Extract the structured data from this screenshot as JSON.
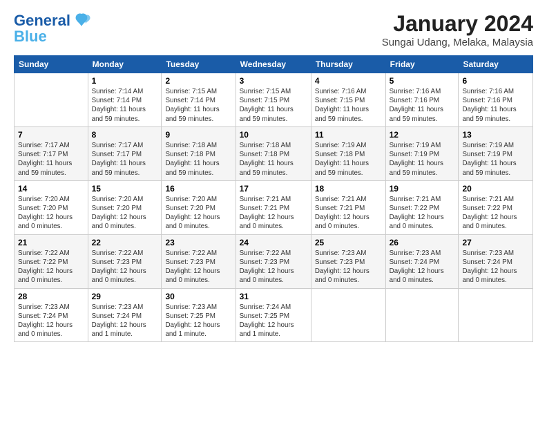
{
  "logo": {
    "line1": "General",
    "line2": "Blue"
  },
  "title": "January 2024",
  "subtitle": "Sungai Udang, Melaka, Malaysia",
  "days": [
    "Sunday",
    "Monday",
    "Tuesday",
    "Wednesday",
    "Thursday",
    "Friday",
    "Saturday"
  ],
  "weeks": [
    [
      {
        "day": "",
        "info": ""
      },
      {
        "day": "1",
        "info": "Sunrise: 7:14 AM\nSunset: 7:14 PM\nDaylight: 11 hours\nand 59 minutes."
      },
      {
        "day": "2",
        "info": "Sunrise: 7:15 AM\nSunset: 7:14 PM\nDaylight: 11 hours\nand 59 minutes."
      },
      {
        "day": "3",
        "info": "Sunrise: 7:15 AM\nSunset: 7:15 PM\nDaylight: 11 hours\nand 59 minutes."
      },
      {
        "day": "4",
        "info": "Sunrise: 7:16 AM\nSunset: 7:15 PM\nDaylight: 11 hours\nand 59 minutes."
      },
      {
        "day": "5",
        "info": "Sunrise: 7:16 AM\nSunset: 7:16 PM\nDaylight: 11 hours\nand 59 minutes."
      },
      {
        "day": "6",
        "info": "Sunrise: 7:16 AM\nSunset: 7:16 PM\nDaylight: 11 hours\nand 59 minutes."
      }
    ],
    [
      {
        "day": "7",
        "info": "Sunrise: 7:17 AM\nSunset: 7:17 PM\nDaylight: 11 hours\nand 59 minutes."
      },
      {
        "day": "8",
        "info": "Sunrise: 7:17 AM\nSunset: 7:17 PM\nDaylight: 11 hours\nand 59 minutes."
      },
      {
        "day": "9",
        "info": "Sunrise: 7:18 AM\nSunset: 7:18 PM\nDaylight: 11 hours\nand 59 minutes."
      },
      {
        "day": "10",
        "info": "Sunrise: 7:18 AM\nSunset: 7:18 PM\nDaylight: 11 hours\nand 59 minutes."
      },
      {
        "day": "11",
        "info": "Sunrise: 7:19 AM\nSunset: 7:18 PM\nDaylight: 11 hours\nand 59 minutes."
      },
      {
        "day": "12",
        "info": "Sunrise: 7:19 AM\nSunset: 7:19 PM\nDaylight: 11 hours\nand 59 minutes."
      },
      {
        "day": "13",
        "info": "Sunrise: 7:19 AM\nSunset: 7:19 PM\nDaylight: 11 hours\nand 59 minutes."
      }
    ],
    [
      {
        "day": "14",
        "info": "Sunrise: 7:20 AM\nSunset: 7:20 PM\nDaylight: 12 hours\nand 0 minutes."
      },
      {
        "day": "15",
        "info": "Sunrise: 7:20 AM\nSunset: 7:20 PM\nDaylight: 12 hours\nand 0 minutes."
      },
      {
        "day": "16",
        "info": "Sunrise: 7:20 AM\nSunset: 7:20 PM\nDaylight: 12 hours\nand 0 minutes."
      },
      {
        "day": "17",
        "info": "Sunrise: 7:21 AM\nSunset: 7:21 PM\nDaylight: 12 hours\nand 0 minutes."
      },
      {
        "day": "18",
        "info": "Sunrise: 7:21 AM\nSunset: 7:21 PM\nDaylight: 12 hours\nand 0 minutes."
      },
      {
        "day": "19",
        "info": "Sunrise: 7:21 AM\nSunset: 7:22 PM\nDaylight: 12 hours\nand 0 minutes."
      },
      {
        "day": "20",
        "info": "Sunrise: 7:21 AM\nSunset: 7:22 PM\nDaylight: 12 hours\nand 0 minutes."
      }
    ],
    [
      {
        "day": "21",
        "info": "Sunrise: 7:22 AM\nSunset: 7:22 PM\nDaylight: 12 hours\nand 0 minutes."
      },
      {
        "day": "22",
        "info": "Sunrise: 7:22 AM\nSunset: 7:23 PM\nDaylight: 12 hours\nand 0 minutes."
      },
      {
        "day": "23",
        "info": "Sunrise: 7:22 AM\nSunset: 7:23 PM\nDaylight: 12 hours\nand 0 minutes."
      },
      {
        "day": "24",
        "info": "Sunrise: 7:22 AM\nSunset: 7:23 PM\nDaylight: 12 hours\nand 0 minutes."
      },
      {
        "day": "25",
        "info": "Sunrise: 7:23 AM\nSunset: 7:23 PM\nDaylight: 12 hours\nand 0 minutes."
      },
      {
        "day": "26",
        "info": "Sunrise: 7:23 AM\nSunset: 7:24 PM\nDaylight: 12 hours\nand 0 minutes."
      },
      {
        "day": "27",
        "info": "Sunrise: 7:23 AM\nSunset: 7:24 PM\nDaylight: 12 hours\nand 0 minutes."
      }
    ],
    [
      {
        "day": "28",
        "info": "Sunrise: 7:23 AM\nSunset: 7:24 PM\nDaylight: 12 hours\nand 0 minutes."
      },
      {
        "day": "29",
        "info": "Sunrise: 7:23 AM\nSunset: 7:24 PM\nDaylight: 12 hours\nand 1 minute."
      },
      {
        "day": "30",
        "info": "Sunrise: 7:23 AM\nSunset: 7:25 PM\nDaylight: 12 hours\nand 1 minute."
      },
      {
        "day": "31",
        "info": "Sunrise: 7:24 AM\nSunset: 7:25 PM\nDaylight: 12 hours\nand 1 minute."
      },
      {
        "day": "",
        "info": ""
      },
      {
        "day": "",
        "info": ""
      },
      {
        "day": "",
        "info": ""
      }
    ]
  ]
}
